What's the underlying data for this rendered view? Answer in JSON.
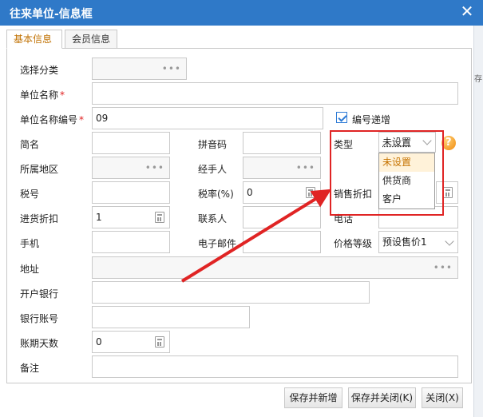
{
  "window": {
    "title": "往来单位-信息框",
    "close_glyph": "✕"
  },
  "side_fragment": "存",
  "tabs": [
    {
      "label": "基本信息",
      "active": true
    },
    {
      "label": "会员信息",
      "active": false
    }
  ],
  "form": {
    "category": {
      "label": "选择分类",
      "value": ""
    },
    "unit_name": {
      "label": "单位名称",
      "required_mark": "*",
      "value": ""
    },
    "unit_code": {
      "label": "单位名称编号",
      "required_mark": "*",
      "value": "09"
    },
    "auto_increment": {
      "label": "编号递增",
      "checked": true
    },
    "short_name": {
      "label": "简名",
      "value": ""
    },
    "pinyin": {
      "label": "拼音码",
      "value": ""
    },
    "type": {
      "label": "类型",
      "value": "未设置",
      "options": [
        "未设置",
        "供货商",
        "客户"
      ]
    },
    "region": {
      "label": "所属地区",
      "value": ""
    },
    "handler": {
      "label": "经手人",
      "value": ""
    },
    "tax_no": {
      "label": "税号",
      "value": ""
    },
    "tax_rate": {
      "label": "税率(%)",
      "value": "0"
    },
    "sales_discount": {
      "label": "销售折扣",
      "value": ""
    },
    "purchase_discount": {
      "label": "进货折扣",
      "value": "1"
    },
    "contact": {
      "label": "联系人",
      "value": ""
    },
    "phone": {
      "label": "电话",
      "value": ""
    },
    "mobile": {
      "label": "手机",
      "value": ""
    },
    "email": {
      "label": "电子邮件",
      "value": ""
    },
    "price_level": {
      "label": "价格等级",
      "value": "预设售价1"
    },
    "address": {
      "label": "地址",
      "value": ""
    },
    "bank": {
      "label": "开户银行",
      "value": ""
    },
    "bank_account": {
      "label": "银行账号",
      "value": ""
    },
    "credit_days": {
      "label": "账期天数",
      "value": "0"
    },
    "remark": {
      "label": "备注",
      "value": ""
    }
  },
  "buttons": {
    "save_new": "保存并新增",
    "save_close": "保存并关闭(K)",
    "close": "关闭(X)"
  },
  "colors": {
    "title_bar": "#2f79c8",
    "highlight_box": "#e02424",
    "active_tab_text": "#c07000",
    "selected_option_bg": "#fff2d9"
  }
}
